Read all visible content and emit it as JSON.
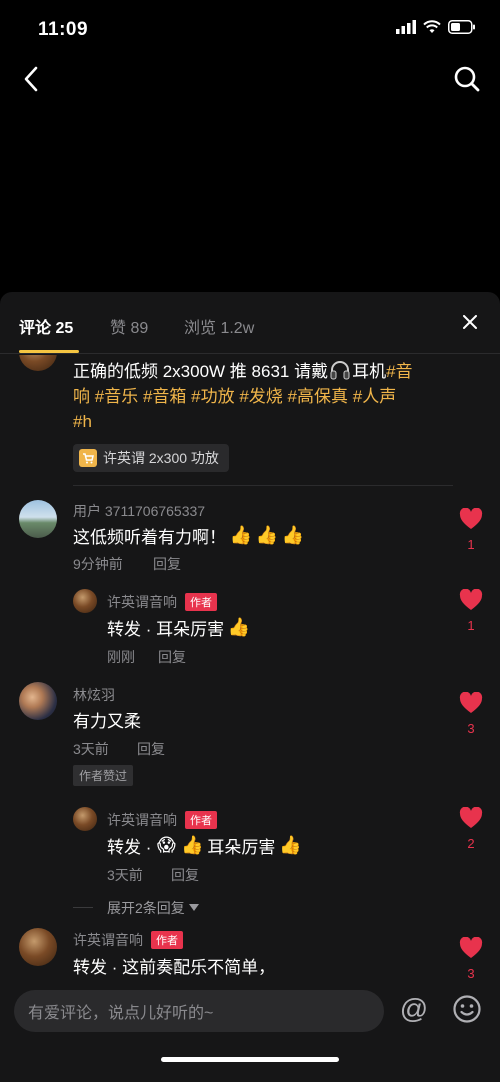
{
  "status": {
    "time": "11:09"
  },
  "tabs": [
    {
      "label": "评论 25"
    },
    {
      "label": "赞 89"
    },
    {
      "label": "浏览 1.2w"
    }
  ],
  "post": {
    "line1_plain": "正确的低频 2x300W 推 8631 请戴",
    "line1_after": "耳机",
    "line1_tag": "#音",
    "line2_tag_a": "响",
    "line2_tag_b": "#音乐",
    "line2_tag_c": "#音箱",
    "line2_tag_d": "#功放",
    "line2_tag_e": "#发烧",
    "line2_tag_f": "#高保真",
    "line2_tag_g": "#人声",
    "line3_tag": "#h",
    "product": "许英谓 2x300 功放"
  },
  "comments": [
    {
      "username": "用户 3711706765337",
      "text": "这低频听着有力啊！",
      "time": "9分钟前",
      "reply_label": "回复",
      "likes": "1",
      "reply": {
        "username": "许英谓音响",
        "badge": "作者",
        "text": "转发 · 耳朵厉害",
        "time": "刚刚",
        "reply_label": "回复",
        "likes": "1"
      }
    },
    {
      "username": "林炫羽",
      "text": "有力又柔",
      "time": "3天前",
      "reply_label": "回复",
      "liked_badge": "作者赞过",
      "likes": "3",
      "reply": {
        "username": "许英谓音响",
        "badge": "作者",
        "text_a": "转发 ·",
        "text_b": "耳朵厉害",
        "time": "3天前",
        "reply_label": "回复",
        "likes": "2"
      },
      "expand": "展开2条回复"
    },
    {
      "username": "许英谓音响",
      "badge": "作者",
      "text": "转发 · 这前奏配乐不简单，",
      "likes": "3"
    }
  ],
  "input": {
    "placeholder": "有爱评论，说点儿好听的~"
  },
  "colors": {
    "accent": "#f5c542",
    "heart": "#e8334d",
    "tag": "#f0b54a"
  }
}
